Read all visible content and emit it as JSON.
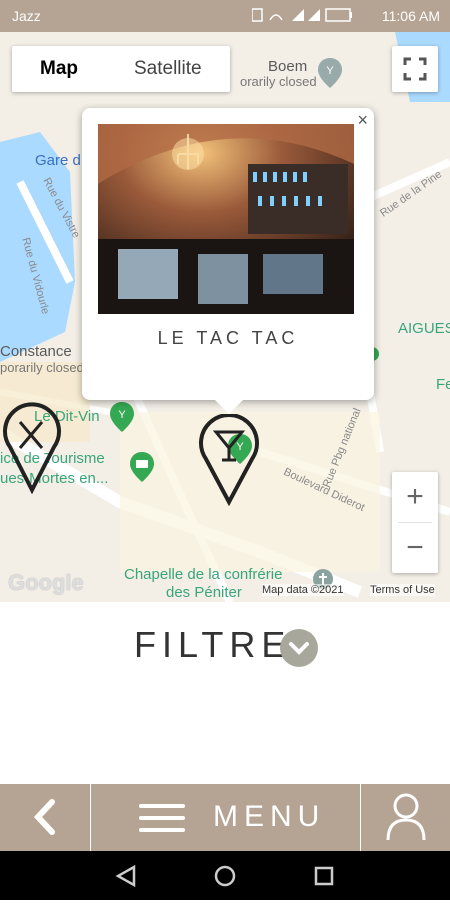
{
  "status_bar": {
    "carrier": "Jazz",
    "battery": "72",
    "time": "11:06 AM"
  },
  "map": {
    "type_control": {
      "map_label": "Map",
      "satellite_label": "Satellite"
    },
    "labels": {
      "gare": "Gare d",
      "boem": "Boem",
      "temporarily_closed_1": "orarily closed",
      "rue_de_la_pine": "Rue de la Pine",
      "rue_du_vistre": "Rue du Vistre",
      "rue_du_vidourle": "Rue du Vidourle",
      "aigues": "AIGUES",
      "constance": "Constance",
      "temporarily_closed_2": "porarily closed",
      "le_dit_vin": "Le Dit-Vin",
      "fe": "Fe",
      "office_tourisme": "ice de Tourisme",
      "aigues_mortes": "ues-Mortes en...",
      "rue_pbg": "Rue Pbg national",
      "boulevard": "Boulevard Diderot",
      "chapelle_1": "Chapelle de la confrérie",
      "chapelle_2": "des Péniter"
    },
    "popup": {
      "close": "×",
      "title": "LE TAC TAC"
    },
    "zoom": {
      "in": "+",
      "out": "−"
    },
    "google_logo": "Google",
    "map_data": "Map data ©2021",
    "terms": "Terms of Use",
    "colors": {
      "water": "#aadaff",
      "land": "#f3efe7",
      "road": "#ffffff",
      "marker": "#222222",
      "pin_green": "#34a853"
    }
  },
  "filters": {
    "label": "FILTRES",
    "chevron": "chevron-down-icon"
  },
  "bottom_menu": {
    "back_icon": "chevron-left-icon",
    "menu_icon": "hamburger-icon",
    "menu_label": "MENU",
    "user_icon": "user-icon",
    "color": "#b5a493"
  },
  "nav": {
    "back": "back-triangle-icon",
    "home": "home-circle-icon",
    "recents": "recents-square-icon"
  }
}
